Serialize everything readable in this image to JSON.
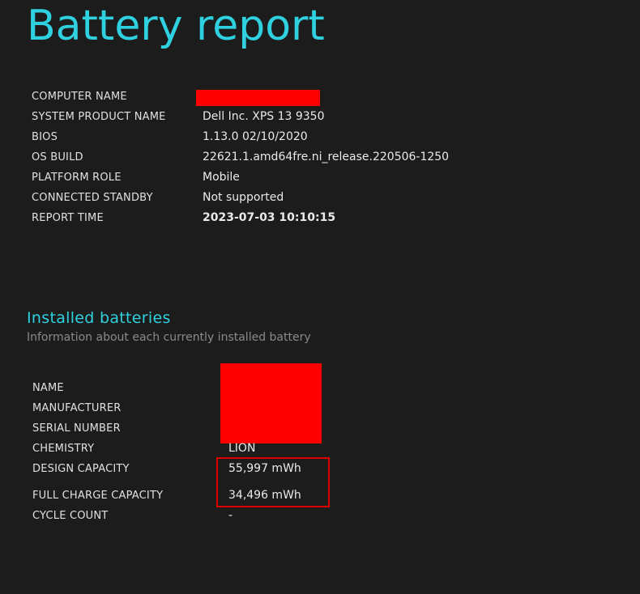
{
  "page": {
    "title": "Battery report"
  },
  "system_info": {
    "rows": [
      {
        "label": "COMPUTER NAME",
        "value": ""
      },
      {
        "label": "SYSTEM PRODUCT NAME",
        "value": "Dell Inc. XPS 13 9350"
      },
      {
        "label": "BIOS",
        "value": "1.13.0 02/10/2020"
      },
      {
        "label": "OS BUILD",
        "value": "22621.1.amd64fre.ni_release.220506-1250"
      },
      {
        "label": "PLATFORM ROLE",
        "value": "Mobile"
      },
      {
        "label": "CONNECTED STANDBY",
        "value": "Not supported"
      },
      {
        "label": "REPORT TIME",
        "value": "2023-07-03  10:10:15"
      }
    ]
  },
  "installed_batteries": {
    "heading": "Installed batteries",
    "subtitle": "Information about each currently installed battery",
    "rows": [
      {
        "label": "NAME",
        "value": ""
      },
      {
        "label": "MANUFACTURER",
        "value": ""
      },
      {
        "label": "SERIAL NUMBER",
        "value": ""
      },
      {
        "label": "CHEMISTRY",
        "value": "LION"
      },
      {
        "label": "DESIGN CAPACITY",
        "value": "55,997 mWh"
      },
      {
        "label": "FULL CHARGE CAPACITY",
        "value": "34,496 mWh"
      },
      {
        "label": "CYCLE COUNT",
        "value": "-"
      }
    ]
  },
  "colors": {
    "background": "#1c1c1c",
    "accent": "#2fd1e0",
    "redaction": "#ff0000",
    "highlight_border": "#e00000"
  }
}
